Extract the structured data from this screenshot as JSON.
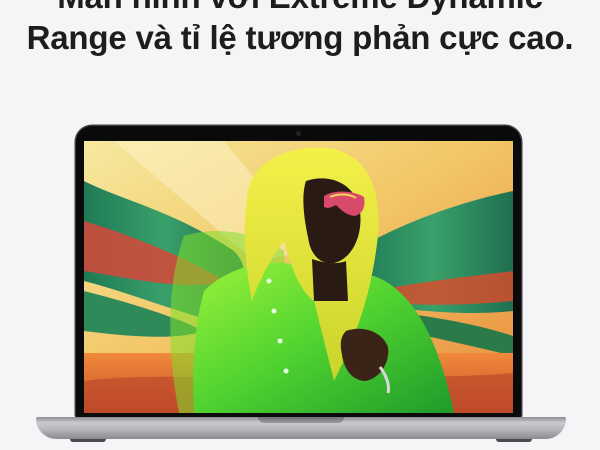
{
  "headline": {
    "line1": "Màn hình với Extreme Dynamic",
    "line2": "Range và tỉ lệ tương phản cực cao."
  },
  "colors": {
    "page_background": "#f5f5f7",
    "headline_text": "#1d1d1f",
    "device_finish": "space-gray",
    "screen_image_accents": [
      "#f4e08a",
      "#2f8a5a",
      "#7fe02a",
      "#ffe24a",
      "#f08a3a"
    ]
  },
  "product_image": {
    "device": "laptop",
    "screen_content": "person in bright green raincoat with yellow hood and sunglasses against colorful abstract background"
  }
}
